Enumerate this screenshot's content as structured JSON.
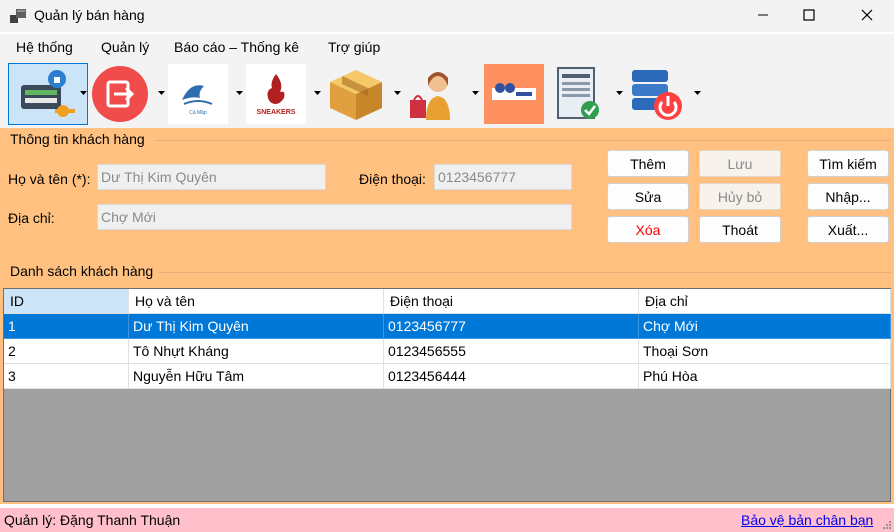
{
  "window": {
    "title": "Quản lý bán hàng",
    "minimize_symbol": "—",
    "maximize_symbol": "☐",
    "close_symbol": "✕"
  },
  "menu": [
    "Hệ thống",
    "Quản lý",
    "Báo cáo – Thống kê",
    "Trợ giúp"
  ],
  "toolbar": {
    "icons": [
      "login-key-icon",
      "logout-icon",
      "shark-logo-icon",
      "sneakers-logo-icon",
      "product-box-icon",
      "shopping-person-icon",
      "staff-banner-icon",
      "invoice-check-icon",
      "server-power-icon"
    ],
    "logo_texts": {
      "shark": "Cá Mập",
      "sneakers": "SNEAKERS"
    }
  },
  "customer_info": {
    "group_title": "Thông tin khách hàng",
    "name_label": "Họ và tên (*):",
    "name_value": "Dư Thị Kim Quyên",
    "phone_label": "Điện thoại:",
    "phone_value": "0123456777",
    "address_label": "Địa chỉ:",
    "address_value": "Chợ Mới"
  },
  "buttons": {
    "add": "Thêm",
    "save": "Lưu",
    "search": "Tìm kiếm",
    "edit": "Sửa",
    "cancel": "Hủy bỏ",
    "import": "Nhập...",
    "delete": "Xóa",
    "exit": "Thoát",
    "export": "Xuất..."
  },
  "customer_list": {
    "group_title": "Danh sách khách hàng",
    "columns": [
      "ID",
      "Họ và tên",
      "Điện thoại",
      "Địa chỉ"
    ],
    "rows": [
      [
        "1",
        "Dư Thị Kim Quyên",
        "0123456777",
        "Chợ Mới"
      ],
      [
        "2",
        "Tô Nhựt Kháng",
        "0123456555",
        "Thoại Sơn"
      ],
      [
        "3",
        "Nguyễn Hữu Tâm",
        "0123456444",
        "Phú Hòa"
      ]
    ],
    "selected_row": 0
  },
  "status": {
    "manager": "Quản lý: Đặng Thanh Thuận",
    "copyright_link": "Bảo vệ bản chân bạn"
  },
  "colors": {
    "panel": "#ffc080",
    "status_bar": "#ffc0cb",
    "selection": "#0078d7",
    "grid_background": "#a0a0a0"
  }
}
